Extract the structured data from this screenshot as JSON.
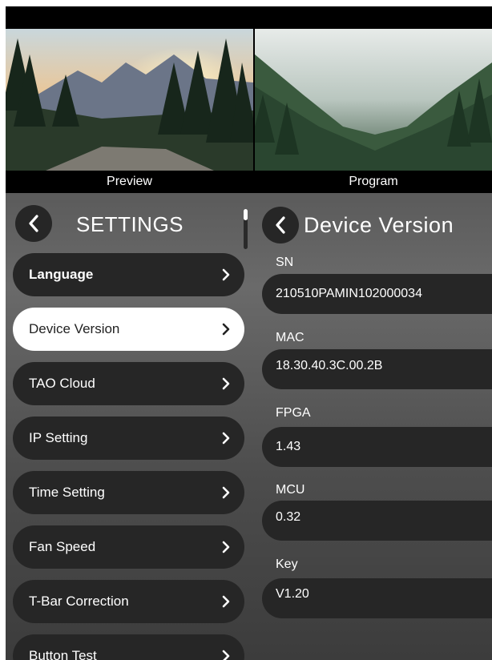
{
  "monitors": {
    "preview_label": "Preview",
    "program_label": "Program"
  },
  "settings": {
    "title": "SETTINGS",
    "back_icon": "chevron-left-icon",
    "menu": [
      {
        "label": "Language",
        "active": false
      },
      {
        "label": "Device Version",
        "active": true
      },
      {
        "label": "TAO Cloud",
        "active": false
      },
      {
        "label": "IP Setting",
        "active": false
      },
      {
        "label": "Time Setting",
        "active": false
      },
      {
        "label": "Fan Speed",
        "active": false
      },
      {
        "label": "T-Bar Correction",
        "active": false
      },
      {
        "label": "Button Test",
        "active": false
      }
    ]
  },
  "device_version": {
    "title": "Device Version",
    "fields": [
      {
        "label": "SN",
        "value": "210510PAMIN102000034"
      },
      {
        "label": "MAC",
        "value": "18.30.40.3C.00.2B"
      },
      {
        "label": "FPGA",
        "value": "1.43"
      },
      {
        "label": "MCU",
        "value": "0.32"
      },
      {
        "label": "Key",
        "value": "V1.20"
      }
    ]
  },
  "colors": {
    "panel_dark": "#262626",
    "active_item": "#ffffff",
    "text": "#ffffff"
  }
}
